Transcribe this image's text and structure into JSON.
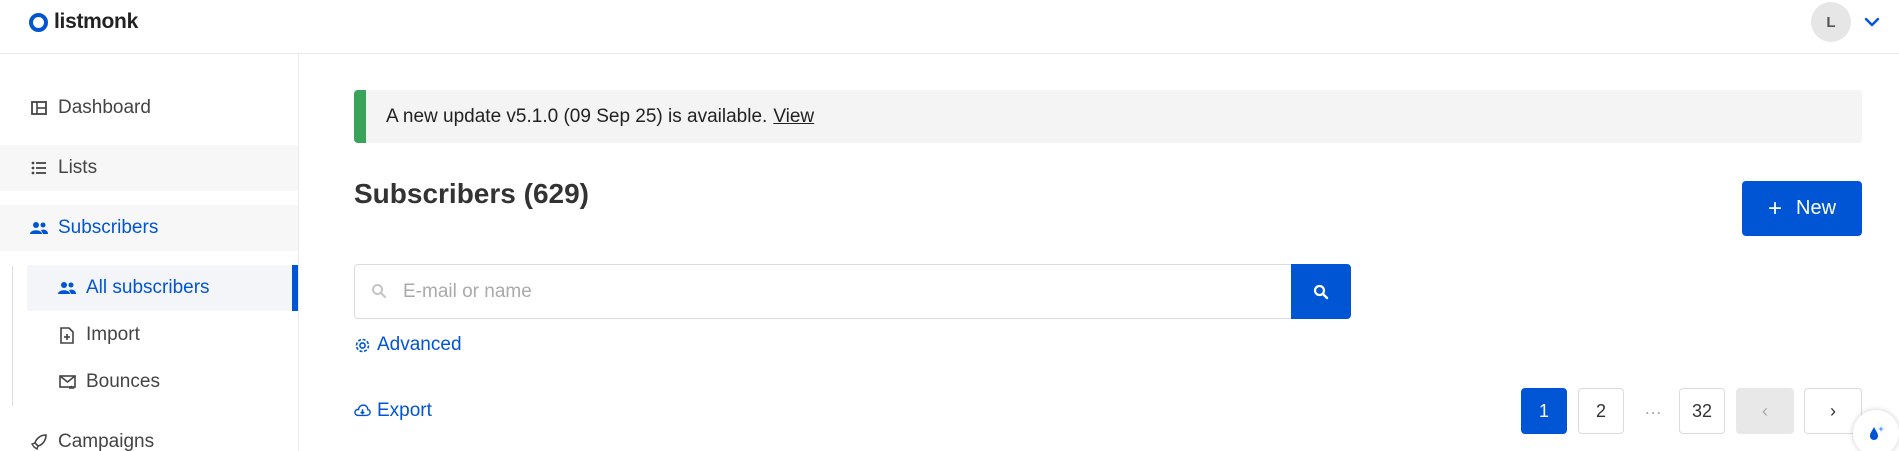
{
  "app": {
    "logo_text": "listmonk"
  },
  "header": {
    "avatar_initial": "L"
  },
  "sidebar": {
    "items": [
      {
        "label": "Dashboard",
        "icon": "dashboard-icon"
      },
      {
        "label": "Lists",
        "icon": "list-icon"
      },
      {
        "label": "Subscribers",
        "icon": "users-icon"
      },
      {
        "label": "Campaigns",
        "icon": "rocket-icon"
      }
    ],
    "sub_items": [
      {
        "label": "All subscribers",
        "icon": "users-icon"
      },
      {
        "label": "Import",
        "icon": "file-import-icon"
      },
      {
        "label": "Bounces",
        "icon": "email-bounce-icon"
      }
    ]
  },
  "notice": {
    "text": "A new update v5.1.0 (09 Sep 25) is available.",
    "link": "View"
  },
  "main": {
    "title": "Subscribers (629)",
    "new_button": "New",
    "search_placeholder": "E-mail or name",
    "advanced_label": "Advanced",
    "export_label": "Export"
  },
  "pagination": {
    "pages": [
      "1",
      "2",
      "32"
    ],
    "ellipsis": "…",
    "current": "1",
    "prev_label": "‹",
    "next_label": "›"
  },
  "colors": {
    "accent": "#0055d4",
    "notice_bar": "#3aa35a",
    "sidebar_active_bg": "#f3f5f9"
  }
}
